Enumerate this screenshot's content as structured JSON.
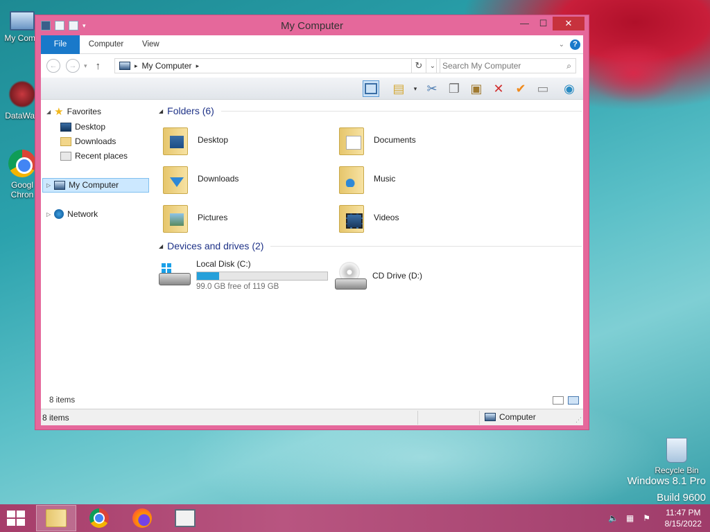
{
  "desktop": {
    "icons": [
      {
        "label": "My Comp"
      },
      {
        "label": "DataWag"
      },
      {
        "label": "Googl Chron"
      },
      {
        "label": "Recycle Bin"
      }
    ],
    "watermark": {
      "line1": "Windows 8.1 Pro",
      "line2": "Build 9600"
    }
  },
  "window": {
    "title": "My Computer",
    "controls": {
      "minimize": "—",
      "maximize": "☐",
      "close": "✕"
    },
    "ribbon": {
      "tabs": [
        "File",
        "Computer",
        "View"
      ],
      "help": "?"
    },
    "address": {
      "back": "←",
      "forward": "→",
      "up": "↑",
      "path": "My Computer",
      "search_placeholder": "Search My Computer"
    },
    "nav": {
      "favorites": "Favorites",
      "items": [
        "Desktop",
        "Downloads",
        "Recent places"
      ],
      "my_computer": "My Computer",
      "network": "Network"
    },
    "groups": {
      "folders": "Folders (6)",
      "devices": "Devices and drives (2)"
    },
    "folders": [
      "Desktop",
      "Documents",
      "Downloads",
      "Music",
      "Pictures",
      "Videos"
    ],
    "drives": [
      {
        "name": "Local Disk (C:)",
        "free": "99.0 GB free of 119 GB",
        "used_fraction": 0.17
      },
      {
        "name": "CD Drive (D:)"
      }
    ],
    "content_count": "8 items",
    "status": {
      "count": "8 items",
      "zone": "Computer"
    }
  },
  "taskbar": {
    "time": "11:47 PM",
    "date": "8/15/2022"
  },
  "colors": {
    "window_frame": "#e5689b",
    "accent": "#1979ca",
    "taskbar": "#b85580",
    "progress": "#26a0da"
  }
}
